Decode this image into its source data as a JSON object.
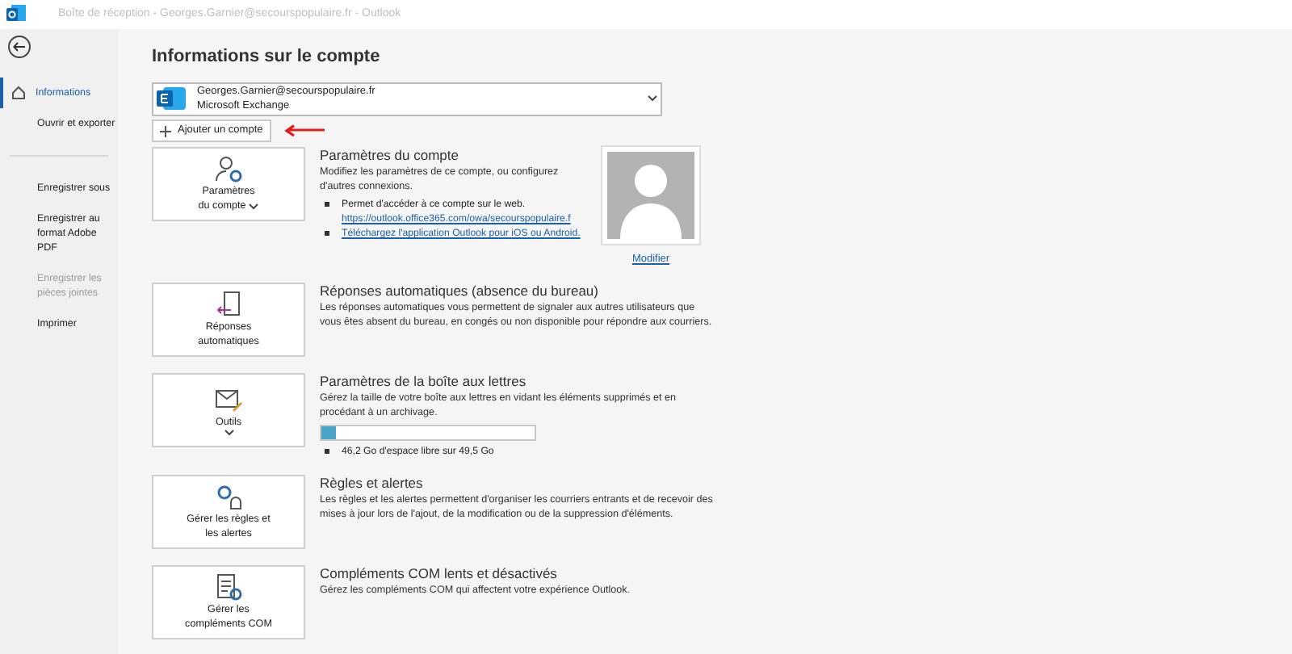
{
  "window": {
    "title": "Boîte de réception - Georges.Garnier@secourspopulaire.fr  -  Outlook"
  },
  "sidebar": {
    "items": [
      {
        "label": "Informations",
        "selected": true,
        "disabled": false
      },
      {
        "label": "Ouvrir et exporter",
        "selected": false,
        "disabled": false
      },
      {
        "label": "Enregistrer sous",
        "selected": false,
        "disabled": false
      },
      {
        "label": "Enregistrer au format Adobe PDF",
        "selected": false,
        "disabled": false
      },
      {
        "label": "Enregistrer les pièces jointes",
        "selected": false,
        "disabled": true
      },
      {
        "label": "Imprimer",
        "selected": false,
        "disabled": false
      }
    ]
  },
  "page": {
    "title": "Informations sur le compte",
    "account": {
      "email": "Georges.Garnier@secourspopulaire.fr",
      "type": "Microsoft Exchange"
    },
    "add_account": "Ajouter un compte",
    "sections": [
      {
        "kind": "account",
        "tile": [
          "Paramètres",
          "du compte"
        ],
        "dropdown": true,
        "title": "Paramètres du compte",
        "description": "Modifiez les paramètres de ce compte, ou configurez d'autres connexions.",
        "bullets": [
          {
            "text": "Permet d'accéder à ce compte sur le web.",
            "link": "https://outlook.office365.com/owa/secourspopulaire.f"
          },
          {
            "link": "Téléchargez l'application Outlook pour iOS ou Android."
          }
        ],
        "photo_link": "Modifier"
      },
      {
        "kind": "auto-reply",
        "tile": [
          "Réponses",
          "automatiques"
        ],
        "dropdown": false,
        "title": "Réponses automatiques (absence du bureau)",
        "description": "Les réponses automatiques vous permettent de signaler aux autres utilisateurs que vous êtes absent du bureau, en congés ou non disponible pour répondre aux courriers."
      },
      {
        "kind": "tools",
        "tile": [
          "Outils"
        ],
        "dropdown": true,
        "title": "Paramètres de la boîte aux lettres",
        "description": "Gérez la taille de votre boîte aux lettres en vidant les éléments supprimés et en procédant à un archivage.",
        "level": 0.07,
        "bullets": [
          {
            "text": "46,2 Go d'espace libre sur 49,5 Go"
          }
        ]
      },
      {
        "kind": "rules",
        "tile": [
          "Gérer les règles et",
          "les alertes"
        ],
        "dropdown": false,
        "title": "Règles et alertes",
        "description": "Les règles et les alertes permettent d'organiser les courriers entrants et de recevoir des mises à jour lors de l'ajout, de la modification ou de la suppression d'éléments."
      },
      {
        "kind": "com",
        "tile": [
          "Gérer les",
          "compléments COM"
        ],
        "dropdown": false,
        "title": "Compléments COM lents et désactivés",
        "description": "Gérez les compléments COM qui affectent votre expérience Outlook."
      }
    ]
  }
}
